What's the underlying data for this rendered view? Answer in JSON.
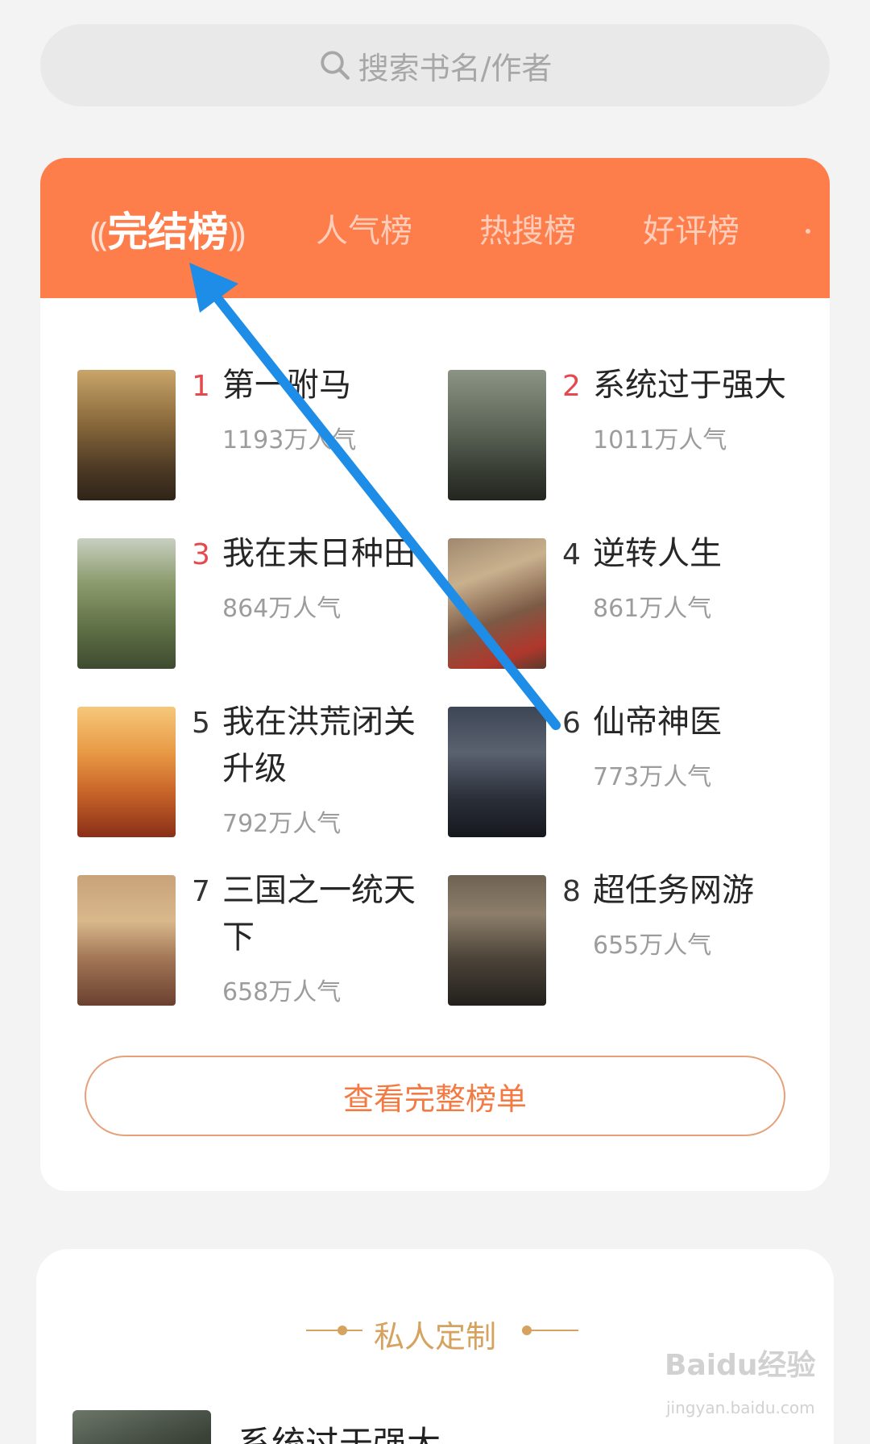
{
  "search": {
    "placeholder": "搜索书名/作者"
  },
  "rank_tabs": [
    "完结榜",
    "人气榜",
    "热搜榜",
    "好评榜"
  ],
  "books": [
    {
      "rank": "1",
      "title": "第一驸马",
      "popularity": "1193万人气"
    },
    {
      "rank": "2",
      "title": "系统过于强大",
      "popularity": "1011万人气"
    },
    {
      "rank": "3",
      "title": "我在末日种田",
      "popularity": "864万人气"
    },
    {
      "rank": "4",
      "title": "逆转人生",
      "popularity": "861万人气"
    },
    {
      "rank": "5",
      "title": "我在洪荒闭关升级",
      "popularity": "792万人气"
    },
    {
      "rank": "6",
      "title": "仙帝神医",
      "popularity": "773万人气"
    },
    {
      "rank": "7",
      "title": "三国之一统天下",
      "popularity": "658万人气"
    },
    {
      "rank": "8",
      "title": "超任务网游",
      "popularity": "655万人气"
    }
  ],
  "more_button": "查看完整榜单",
  "custom": {
    "title": "私人定制",
    "book_title": "系统过于强大"
  },
  "watermark": {
    "brand": "Baidu经验",
    "url": "jingyan.baidu.com"
  },
  "colors": {
    "accent": "#fd7d4b",
    "rank_red": "#e5484d",
    "gold": "#d6a25f",
    "arrow": "#1e8de8"
  }
}
